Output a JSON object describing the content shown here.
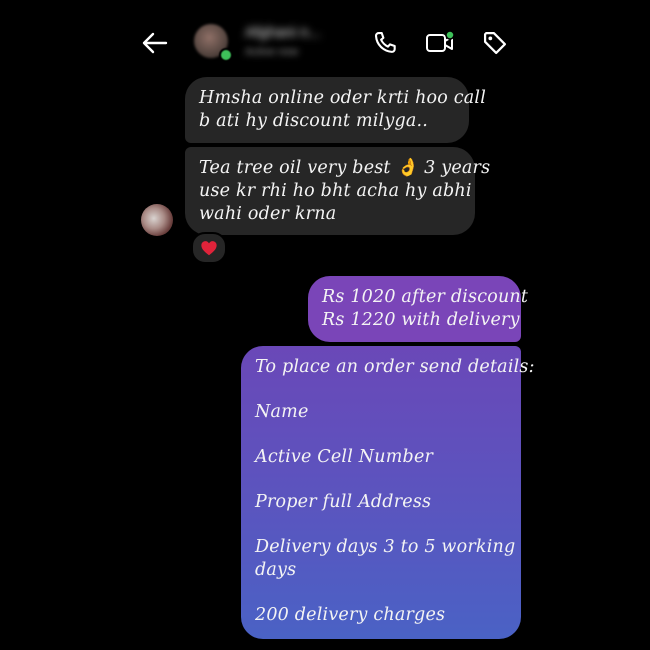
{
  "header": {
    "contact_name": "Afghani n...",
    "contact_status": "Active now"
  },
  "messages": {
    "incoming": [
      {
        "lines": [
          "Hmsha online oder krti hoo call",
          "b ati hy discount milyga.."
        ]
      },
      {
        "lines": [
          "Tea tree oil very best 👌 3 years",
          "use kr rhi ho bht acha hy abhi",
          "wahi oder krna"
        ]
      }
    ],
    "reaction": "heart",
    "outgoing_price": {
      "lines": [
        "Rs 1020 after discount",
        "Rs 1220 with delivery"
      ]
    },
    "outgoing_details": {
      "paragraphs": [
        "To place an order send details:",
        "Name",
        "Active Cell Number",
        "Proper full Address",
        "Delivery days 3 to 5 working\ndays",
        "200 delivery charges"
      ]
    }
  },
  "colors": {
    "background": "#000000",
    "incoming_bubble": "#262626",
    "outgoing_top": "#7a45b8",
    "outgoing_bottom": "#4a62c5",
    "online": "#3ec15a",
    "reaction_heart": "#e0233a"
  },
  "icons": [
    "back-arrow-icon",
    "phone-icon",
    "video-call-icon",
    "tag-icon",
    "heart-icon"
  ]
}
